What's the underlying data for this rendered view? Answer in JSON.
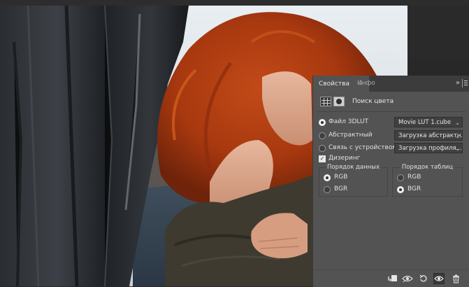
{
  "panel": {
    "tabs": [
      {
        "label": "Свойства",
        "active": true
      },
      {
        "label": "Инфо",
        "active": false
      }
    ],
    "menu_glyph": "››",
    "adjustment_title": "Поиск цвета",
    "options": {
      "file_3dlut": {
        "label": "Файл 3DLUT",
        "selected": true,
        "value": "Movie LUT 1.cube"
      },
      "abstract": {
        "label": "Абстрактный",
        "selected": false,
        "value": "Загрузка абстрактн..."
      },
      "device_link": {
        "label": "Связь с устройством",
        "selected": false,
        "value": "Загрузка профиля..."
      }
    },
    "dither": {
      "label": "Дизеринг",
      "checked": true
    },
    "data_order": {
      "title": "Порядок данных",
      "rgb": {
        "label": "RGB",
        "selected": true
      },
      "bgr": {
        "label": "BGR",
        "selected": false
      }
    },
    "table_order": {
      "title": "Порядок таблиц",
      "rgb": {
        "label": "RGB",
        "selected": false
      },
      "bgr": {
        "label": "BGR",
        "selected": true
      }
    },
    "toolbar": [
      "clip-to-layer-icon",
      "view-previous-state-icon",
      "reset-icon",
      "visibility-eye-icon",
      "trash-icon"
    ]
  },
  "colors": {
    "panel_bg": "#535353",
    "tab_bar_bg": "#3c3c3c",
    "select_bg": "#404040",
    "app_bg": "#282828"
  }
}
